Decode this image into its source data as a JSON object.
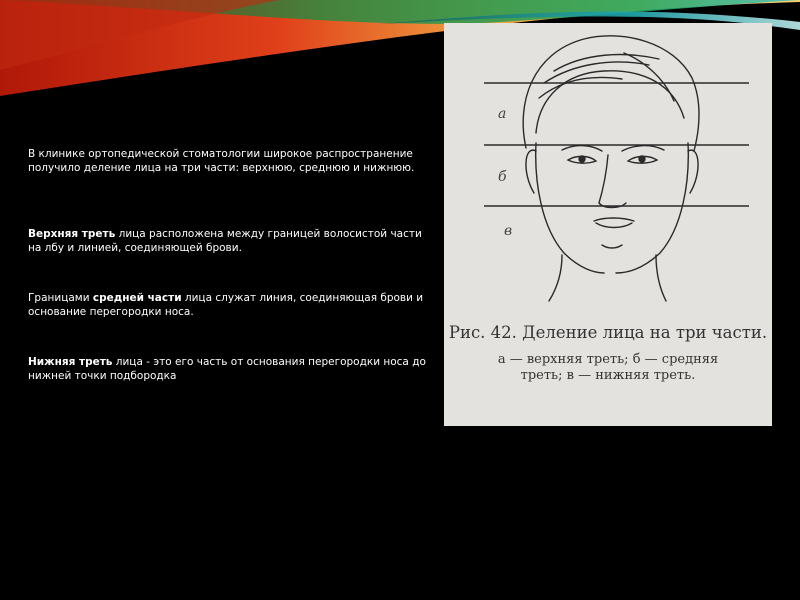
{
  "slide": {
    "paragraphs": {
      "p1": "В клинике ортопедической стоматологии широкое распространение получило деление лица на три части: верхнюю, среднюю и нижнюю.",
      "p2_bold": "Верхняя треть",
      "p2_rest": " лица расположена между границей волосистой части на лбу и линией, соединяющей брови.",
      "p3_pre": "Границами ",
      "p3_bold": "средней части",
      "p3_rest": " лица служат линия, соединяющая брови и основание перегородки носа.",
      "p4_bold": "Нижняя треть",
      "p4_rest": " лица - это его часть от основания перегородки носа до нижней точки подбородка"
    },
    "figure": {
      "labels": [
        "а",
        "б",
        "в"
      ],
      "caption_title": "Рис. 42. Деление лица на три части.",
      "caption_line1": "а — верхняя   треть;   б — средняя",
      "caption_line2": "треть; в — нижняя треть."
    },
    "colors": {
      "background": "#000000",
      "text": "#ffffff",
      "swoosh_red": "#d42a10",
      "swoosh_orange": "#f09030",
      "swoosh_green": "#1fa050",
      "swoosh_teal": "#20a8b0"
    }
  }
}
